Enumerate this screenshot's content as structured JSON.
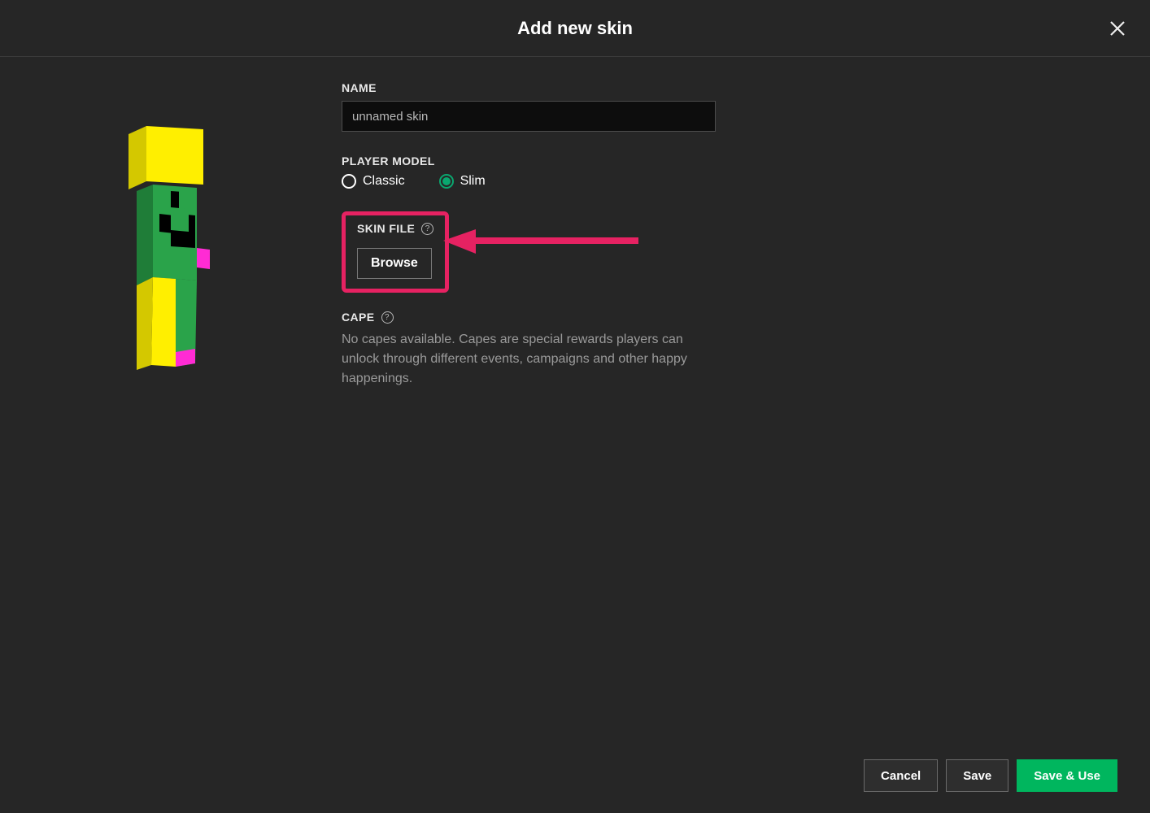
{
  "title": "Add new skin",
  "form": {
    "name_label": "NAME",
    "name_value": "unnamed skin",
    "model_label": "PLAYER MODEL",
    "model_options": {
      "classic": "Classic",
      "slim": "Slim"
    },
    "model_selected": "slim",
    "skin_file_label": "SKIN FILE",
    "browse_label": "Browse",
    "cape_label": "CAPE",
    "cape_text": "No capes available. Capes are special rewards players can unlock through different events, campaigns and other happy happenings."
  },
  "footer": {
    "cancel": "Cancel",
    "save": "Save",
    "save_use": "Save & Use"
  },
  "annotation": {
    "highlight_target": "skin-file-section",
    "arrow_color": "#e62262"
  },
  "colors": {
    "accent": "#00b65e",
    "highlight": "#e62262"
  }
}
